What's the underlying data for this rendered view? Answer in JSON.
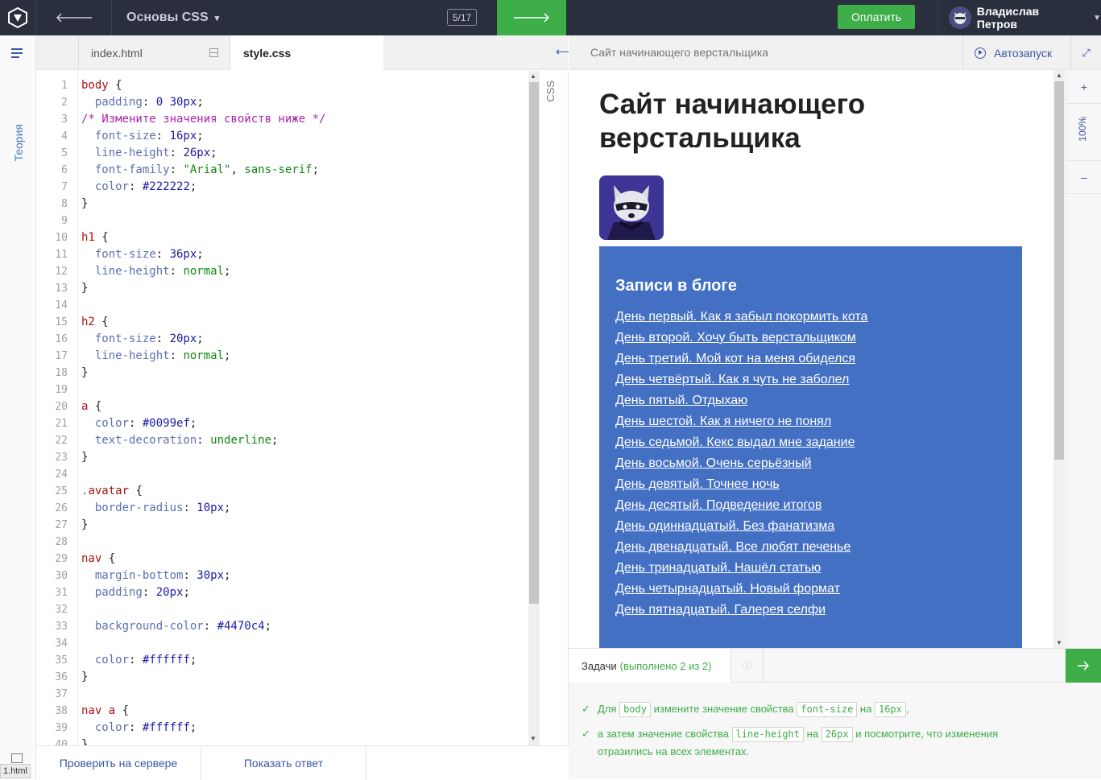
{
  "topbar": {
    "course_title": "Основы CSS",
    "progress": "5/17",
    "pay_label": "Оплатить",
    "user_name": "Владислав Петров"
  },
  "rail": {
    "theory_label": "Теория"
  },
  "editor": {
    "tabs": [
      {
        "label": "index.html"
      },
      {
        "label": "style.css"
      }
    ],
    "side_label": "CSS",
    "line_numbers": [
      "1",
      "2",
      "3",
      "4",
      "5",
      "6",
      "7",
      "8",
      "9",
      "10",
      "11",
      "12",
      "13",
      "14",
      "15",
      "16",
      "17",
      "18",
      "19",
      "20",
      "21",
      "22",
      "23",
      "24",
      "25",
      "26",
      "27",
      "28",
      "29",
      "30",
      "31",
      "32",
      "33",
      "34",
      "35",
      "36",
      "37",
      "38",
      "39",
      "40"
    ],
    "code_lines": [
      [
        [
          "sel",
          "body"
        ],
        [
          "",
          "{"
        ]
      ],
      [
        [
          "",
          "  "
        ],
        [
          "prop",
          "padding"
        ],
        [
          "",
          ": "
        ],
        [
          "num",
          "0 30px"
        ],
        [
          "",
          ";"
        ]
      ],
      [
        [
          "cm",
          "/* Измените значения свойств ниже */"
        ]
      ],
      [
        [
          "",
          "  "
        ],
        [
          "prop",
          "font-size"
        ],
        [
          "",
          ": "
        ],
        [
          "num",
          "16px"
        ],
        [
          "",
          ";"
        ]
      ],
      [
        [
          "",
          "  "
        ],
        [
          "prop",
          "line-height"
        ],
        [
          "",
          ": "
        ],
        [
          "num",
          "26px"
        ],
        [
          "",
          ";"
        ]
      ],
      [
        [
          "",
          "  "
        ],
        [
          "prop",
          "font-family"
        ],
        [
          "",
          ": "
        ],
        [
          "str",
          "\"Arial\""
        ],
        [
          "",
          ", "
        ],
        [
          "kw",
          "sans-serif"
        ],
        [
          "",
          ";"
        ]
      ],
      [
        [
          "",
          "  "
        ],
        [
          "prop",
          "color"
        ],
        [
          "",
          ": "
        ],
        [
          "num",
          "#222222"
        ],
        [
          "",
          ";"
        ]
      ],
      [
        [
          "",
          "}"
        ]
      ],
      [
        [
          "",
          ""
        ]
      ],
      [
        [
          "sel",
          "h1"
        ],
        [
          "",
          " {"
        ]
      ],
      [
        [
          "",
          "  "
        ],
        [
          "prop",
          "font-size"
        ],
        [
          "",
          ": "
        ],
        [
          "num",
          "36px"
        ],
        [
          "",
          ";"
        ]
      ],
      [
        [
          "",
          "  "
        ],
        [
          "prop",
          "line-height"
        ],
        [
          "",
          ": "
        ],
        [
          "kw",
          "normal"
        ],
        [
          "",
          ";"
        ]
      ],
      [
        [
          "",
          "}"
        ]
      ],
      [
        [
          "",
          ""
        ]
      ],
      [
        [
          "sel",
          "h2"
        ],
        [
          "",
          " {"
        ]
      ],
      [
        [
          "",
          "  "
        ],
        [
          "prop",
          "font-size"
        ],
        [
          "",
          ": "
        ],
        [
          "num",
          "20px"
        ],
        [
          "",
          ";"
        ]
      ],
      [
        [
          "",
          "  "
        ],
        [
          "prop",
          "line-height"
        ],
        [
          "",
          ": "
        ],
        [
          "kw",
          "normal"
        ],
        [
          "",
          ";"
        ]
      ],
      [
        [
          "",
          "}"
        ]
      ],
      [
        [
          "",
          ""
        ]
      ],
      [
        [
          "sel",
          "a"
        ],
        [
          "",
          " {"
        ]
      ],
      [
        [
          "",
          "  "
        ],
        [
          "prop",
          "color"
        ],
        [
          "",
          ": "
        ],
        [
          "num",
          "#0099ef"
        ],
        [
          "",
          ";"
        ]
      ],
      [
        [
          "",
          "  "
        ],
        [
          "prop",
          "text-decoration"
        ],
        [
          "",
          ": "
        ],
        [
          "kw",
          "underline"
        ],
        [
          "",
          ";"
        ]
      ],
      [
        [
          "",
          "}"
        ]
      ],
      [
        [
          "",
          ""
        ]
      ],
      [
        [
          "prop",
          "."
        ],
        [
          "sel",
          "avatar"
        ],
        [
          "",
          " {"
        ]
      ],
      [
        [
          "",
          "  "
        ],
        [
          "prop",
          "border-radius"
        ],
        [
          "",
          ": "
        ],
        [
          "num",
          "10px"
        ],
        [
          "",
          ";"
        ]
      ],
      [
        [
          "",
          "}"
        ]
      ],
      [
        [
          "",
          ""
        ]
      ],
      [
        [
          "sel",
          "nav"
        ],
        [
          "",
          " {"
        ]
      ],
      [
        [
          "",
          "  "
        ],
        [
          "prop",
          "margin-bottom"
        ],
        [
          "",
          ": "
        ],
        [
          "num",
          "30px"
        ],
        [
          "",
          ";"
        ]
      ],
      [
        [
          "",
          "  "
        ],
        [
          "prop",
          "padding"
        ],
        [
          "",
          ": "
        ],
        [
          "num",
          "20px"
        ],
        [
          "",
          ";"
        ]
      ],
      [
        [
          "",
          ""
        ]
      ],
      [
        [
          "",
          "  "
        ],
        [
          "prop",
          "background-color"
        ],
        [
          "",
          ": "
        ],
        [
          "num",
          "#4470c4"
        ],
        [
          "",
          ";"
        ]
      ],
      [
        [
          "",
          ""
        ]
      ],
      [
        [
          "",
          "  "
        ],
        [
          "prop",
          "color"
        ],
        [
          "",
          ": "
        ],
        [
          "num",
          "#ffffff"
        ],
        [
          "",
          ";"
        ]
      ],
      [
        [
          "",
          "}"
        ]
      ],
      [
        [
          "",
          ""
        ]
      ],
      [
        [
          "sel",
          "nav a"
        ],
        [
          "",
          " {"
        ]
      ],
      [
        [
          "",
          "  "
        ],
        [
          "prop",
          "color"
        ],
        [
          "",
          ": "
        ],
        [
          "num",
          "#ffffff"
        ],
        [
          "",
          ";"
        ]
      ],
      [
        [
          "",
          "}"
        ]
      ]
    ],
    "check_button": "Проверить на сервере",
    "answer_button": "Показать ответ",
    "file_tag": "1.html"
  },
  "preview": {
    "title": "Сайт начинающего верстальщика",
    "autorun_label": "Автозапуск",
    "zoom": "100%",
    "page": {
      "h1": "Сайт начинающего верстальщика",
      "nav_title": "Записи в блоге",
      "links": [
        "День первый. Как я забыл покормить кота",
        "День второй. Хочу быть верстальщиком",
        "День третий. Мой кот на меня обиделся",
        "День четвёртый. Как я чуть не заболел",
        "День пятый. Отдыхаю",
        "День шестой. Как я ничего не понял",
        "День седьмой. Кекс выдал мне задание",
        "День восьмой. Очень серьёзный",
        "День девятый. Точнее ночь",
        "День десятый. Подведение итогов",
        "День одиннадцатый. Без фанатизма",
        "День двенадцатый. Все любят печенье",
        "День тринадцатый. Нашёл статью",
        "День четырнадцатый. Новый формат",
        "День пятнадцатый. Галерея селфи"
      ]
    }
  },
  "tasks": {
    "label": "Задачи",
    "done": "(выполнено 2 из 2)",
    "items": [
      {
        "p1": "Для",
        "c1": "body",
        "p2": "измените значение свойства",
        "c2": "font-size",
        "p3": "на",
        "c3": "16px",
        "p4": ","
      },
      {
        "p1": "а затем значение свойства",
        "c1": "line-height",
        "p2": "на",
        "c2": "26px",
        "p3": "и посмотрите, что изменения отразились на всех элементах.",
        "c3": "",
        "p4": ""
      }
    ]
  },
  "colors": {
    "accent_green": "#3dae48",
    "nav_blue": "#4470c4",
    "topbar": "#2a2f3e"
  }
}
